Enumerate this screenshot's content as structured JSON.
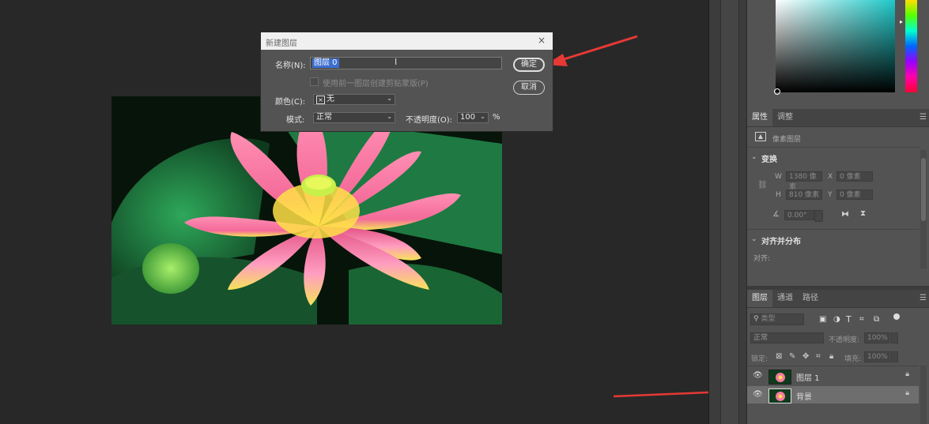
{
  "dialog": {
    "title": "新建图层",
    "close": "×",
    "name_label": "名称(N):",
    "name_value": "图层 0",
    "clip_label": "使用前一图层创建剪贴蒙版(P)",
    "color_label": "颜色(C):",
    "color_value": "无",
    "mode_label": "模式:",
    "mode_value": "正常",
    "opacity_label": "不透明度(O):",
    "opacity_value": "100",
    "opacity_unit": "%",
    "ok_label": "确定",
    "cancel_label": "取消"
  },
  "properties": {
    "tabs": [
      "属性",
      "调整"
    ],
    "layer_type": "像素图层",
    "transform_title": "变换",
    "w_label": "W",
    "w_value": "1380 像素",
    "x_label": "X",
    "x_value": "0 像素",
    "h_label": "H",
    "h_value": "810 像素",
    "y_label": "Y",
    "y_value": "0 像素",
    "angle_value": "0.00°",
    "align_title": "对齐并分布",
    "align_label": "对齐:"
  },
  "layers_panel": {
    "tabs": [
      "图层",
      "通道",
      "路径"
    ],
    "filter_value": "类型",
    "blend_mode": "正常",
    "opacity_label": "不透明度:",
    "opacity_value": "100%",
    "lock_label": "锁定:",
    "fill_label": "填充:",
    "fill_value": "100%",
    "layers": [
      {
        "name": "图层 1",
        "selected": false
      },
      {
        "name": "背景",
        "selected": true
      }
    ]
  },
  "colors": {
    "accent_arrow": "#e53935",
    "selection": "#3d6fd0"
  }
}
